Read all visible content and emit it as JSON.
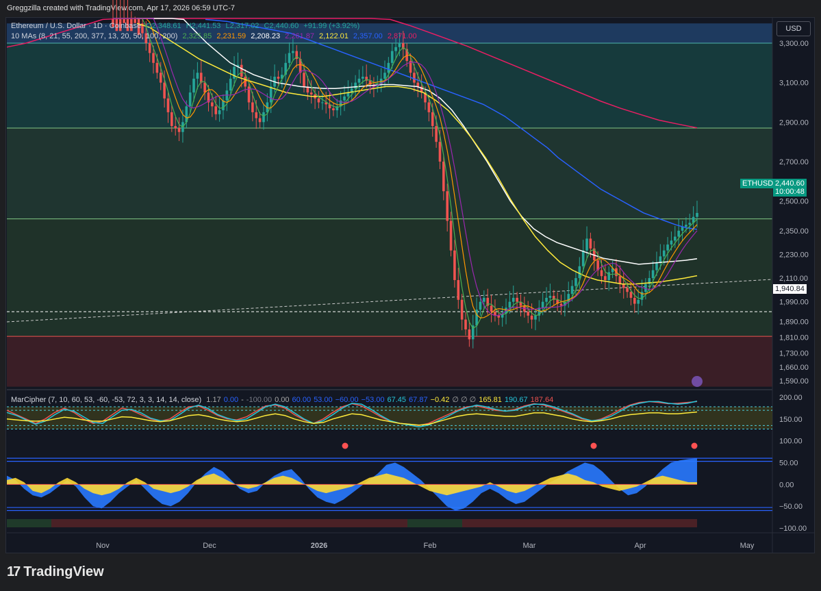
{
  "header": {
    "text": "Greggzilla created with TradingView.com, Apr 17, 2026 06:59 UTC-7"
  },
  "brand": {
    "logo": "17",
    "name": "TradingView"
  },
  "currency": "USD",
  "legend_main": {
    "symbol": "Ethereum / U.S. Dollar · 1D · Coinbase",
    "open": "O2,348.61",
    "high": "H2,441.53",
    "low": "L2,317.02",
    "close": "C2,440.60",
    "change": "+91.99 (+3.92%)"
  },
  "legend_ma": {
    "label": "10 MAs (8, 21, 55, 200, 377, 13, 20, 50, 100, 200)",
    "values": [
      {
        "v": "2,325.85",
        "color": "#4caf50"
      },
      {
        "v": "2,231.59",
        "color": "#ff9800"
      },
      {
        "v": "2,208.23",
        "color": "#ffffff"
      },
      {
        "v": "2,261.87",
        "color": "#9c27b0"
      },
      {
        "v": "2,122.01",
        "color": "#ffeb3b"
      },
      {
        "v": "2,357.00",
        "color": "#2962ff"
      },
      {
        "v": "2,871.00",
        "color": "#e91e63"
      }
    ]
  },
  "legend_mc": {
    "label": "MarCipher (7, 10, 60, 53, -60, -53, 72, 3, 3, 14, 14, close)",
    "values": [
      {
        "v": "1.17",
        "color": "#aaaaaa"
      },
      {
        "v": "0.00",
        "color": "#2962ff"
      },
      {
        "v": "-",
        "color": "#aaaaaa"
      },
      {
        "v": "-100.00",
        "color": "#787b86"
      },
      {
        "v": "0.00",
        "color": "#aaaaaa"
      },
      {
        "v": "60.00",
        "color": "#2962ff"
      },
      {
        "v": "53.00",
        "color": "#2962ff"
      },
      {
        "v": "−60.00",
        "color": "#2962ff"
      },
      {
        "v": "−53.00",
        "color": "#2962ff"
      },
      {
        "v": "67.45",
        "color": "#26c6da"
      },
      {
        "v": "67.87",
        "color": "#2962ff"
      },
      {
        "v": "−0.42",
        "color": "#ffeb3b"
      },
      {
        "v": "∅ ∅ ∅",
        "color": "#aaaaaa"
      },
      {
        "v": "165.81",
        "color": "#ffeb3b"
      },
      {
        "v": "190.67",
        "color": "#26c6da"
      },
      {
        "v": "187.64",
        "color": "#ef5350"
      }
    ]
  },
  "badges": {
    "symbol": "ETHUSD",
    "price": "2,440.60",
    "countdown": "10:00:48",
    "level": "1,940.84"
  },
  "chart_data": {
    "type": "candlestick",
    "x_labels": [
      "Nov",
      "Dec",
      "2026",
      "Feb",
      "Mar",
      "Apr",
      "May"
    ],
    "price_axis_ticks": [
      3300,
      3100,
      2900,
      2700,
      2500,
      2350,
      2230,
      2110,
      1990,
      1890,
      1810,
      1730,
      1660,
      1590
    ],
    "price_axis_labels": [
      "3,300.00",
      "3,100.00",
      "2,900.00",
      "2,700.00",
      "2,500.00",
      "2,350.00",
      "2,230.00",
      "2,110.00",
      "1,990.00",
      "1,890.00",
      "1,810.00",
      "1,730.00",
      "1,660.00",
      "1,590.00"
    ],
    "osc_axis_ticks": [
      200,
      150,
      100,
      50,
      0,
      -50,
      -100
    ],
    "osc_axis_labels": [
      "200.00",
      "150.00",
      "100.00",
      "50.00",
      "0.00",
      "−50.00",
      "−100.00"
    ],
    "zones": [
      {
        "from": 3300,
        "to": 3400,
        "color": "#1e3a5f"
      },
      {
        "from": 2870,
        "to": 3300,
        "color": "#163a3c"
      },
      {
        "from": 2410,
        "to": 2870,
        "color": "#1f3530"
      },
      {
        "from": 1815,
        "to": 2410,
        "color": "#1f3229"
      },
      {
        "from": 1560,
        "to": 1815,
        "color": "#3a1e26"
      }
    ],
    "hlines": [
      3300,
      2870,
      2410,
      1815
    ],
    "close_series": [
      3760,
      3700,
      3640,
      3620,
      3560,
      3500,
      3480,
      3400,
      3350,
      3300,
      3250,
      3200,
      3150,
      3100,
      3020,
      2950,
      2880,
      2870,
      2850,
      2900,
      2980,
      3050,
      3120,
      3150,
      3100,
      3050,
      3000,
      2980,
      2940,
      2960,
      3010,
      3060,
      3120,
      3180,
      3190,
      3130,
      3080,
      3000,
      2950,
      2920,
      2900,
      2950,
      3000,
      3080,
      3130,
      3120,
      3140,
      3200,
      3250,
      3260,
      3220,
      3150,
      3080,
      3050,
      3040,
      3020,
      3000,
      3000,
      2990,
      2970,
      2960,
      2980,
      3010,
      3030,
      3050,
      3070,
      3100,
      3120,
      3130,
      3110,
      3090,
      3080,
      3090,
      3120,
      3150,
      3200,
      3260,
      3280,
      3300,
      3270,
      3210,
      3150,
      3100,
      3080,
      3050,
      3000,
      2950,
      2880,
      2800,
      2700,
      2550,
      2400,
      2250,
      2100,
      2000,
      1900,
      1850,
      1800,
      1870,
      1950,
      1990,
      2010,
      1970,
      1940,
      1920,
      1910,
      1930,
      1960,
      1990,
      2010,
      1990,
      1970,
      1940,
      1920,
      1900,
      1920,
      1960,
      1990,
      2010,
      2020,
      2000,
      1980,
      1970,
      1990,
      2030,
      2070,
      2110,
      2170,
      2250,
      2310,
      2260,
      2200,
      2150,
      2120,
      2100,
      2140,
      2160,
      2120,
      2080,
      2060,
      2040,
      2010,
      1980,
      2000,
      2040,
      2080,
      2110,
      2150,
      2190,
      2220,
      2250,
      2280,
      2300,
      2320,
      2350,
      2370,
      2380,
      2390,
      2420,
      2440
    ],
    "ma_series": [
      {
        "name": "",
        "color": "#2962ff",
        "values": [
          3420,
          3415,
          3410,
          3400,
          3390,
          3380,
          3370,
          3360,
          3350,
          3330,
          3310,
          3290,
          3270,
          3250,
          3230,
          3210,
          3190,
          3170,
          3150,
          3130,
          3110,
          3090,
          3070,
          3050,
          3030,
          3010,
          2990,
          2960,
          2930,
          2890,
          2850,
          2810,
          2770,
          2720,
          2680,
          2640,
          2600,
          2560,
          2530,
          2500,
          2470,
          2440,
          2420,
          2400,
          2380,
          2365,
          2357
        ]
      },
      {
        "name": "",
        "color": "#e91e63",
        "values": [
          3280,
          3300,
          3330,
          3360,
          3390,
          3420,
          3440,
          3460,
          3480,
          3490,
          3500,
          3510,
          3515,
          3520,
          3520,
          3515,
          3505,
          3490,
          3470,
          3445,
          3420,
          3390,
          3355,
          3320,
          3285,
          3245,
          3205,
          3165,
          3125,
          3085,
          3045,
          3005,
          2970,
          2940,
          2910,
          2890,
          2871
        ]
      },
      {
        "name": "",
        "color": "#ffffff",
        "values": [
          3650,
          3600,
          3540,
          3480,
          3420,
          3360,
          3300,
          3250,
          3200,
          3170,
          3140,
          3120,
          3100,
          3090,
          3080,
          3075,
          3070,
          3070,
          3075,
          3080,
          3085,
          3090,
          3090,
          3085,
          3080,
          3060,
          3020,
          2960,
          2880,
          2790,
          2700,
          2600,
          2500,
          2420,
          2360,
          2320,
          2290,
          2270,
          2250,
          2230,
          2210,
          2200,
          2190,
          2180,
          2185,
          2190,
          2195,
          2200,
          2208
        ]
      },
      {
        "name": "",
        "color": "#ffeb3b",
        "values": [
          3400,
          3380,
          3340,
          3300,
          3260,
          3220,
          3190,
          3160,
          3130,
          3110,
          3090,
          3070,
          3050,
          3040,
          3030,
          3030,
          3040,
          3050,
          3060,
          3070,
          3080,
          3080,
          3070,
          3050,
          3010,
          2960,
          2890,
          2810,
          2720,
          2620,
          2510,
          2410,
          2320,
          2250,
          2190,
          2150,
          2120,
          2100,
          2090,
          2080,
          2080,
          2085,
          2090,
          2100,
          2110,
          2122
        ]
      }
    ],
    "osc_series": [
      {
        "name": "",
        "color": "#ef5350",
        "values": [
          170,
          160,
          150,
          140,
          150,
          165,
          175,
          165,
          150,
          140,
          145,
          160,
          175,
          170,
          160,
          150,
          145,
          150,
          165,
          178,
          180,
          170,
          158,
          150,
          148,
          155,
          168,
          180,
          182,
          175,
          160,
          148,
          140,
          150,
          165,
          178,
          185,
          180,
          168,
          155,
          145,
          140,
          138,
          135,
          140,
          150,
          160,
          170,
          178,
          180,
          175,
          170,
          168,
          172,
          180,
          185,
          182,
          175,
          168,
          160,
          150,
          145,
          150,
          160,
          172,
          182,
          188,
          190,
          188,
          185,
          186,
          188,
          190
        ]
      },
      {
        "name": "",
        "color": "#26c6da",
        "values": [
          165,
          158,
          148,
          138,
          145,
          160,
          172,
          168,
          155,
          142,
          140,
          155,
          170,
          172,
          164,
          152,
          146,
          146,
          160,
          175,
          182,
          174,
          160,
          152,
          146,
          150,
          164,
          178,
          184,
          178,
          164,
          150,
          140,
          146,
          160,
          175,
          186,
          184,
          172,
          158,
          146,
          140,
          136,
          132,
          136,
          146,
          156,
          168,
          176,
          182,
          178,
          172,
          168,
          170,
          178,
          184,
          184,
          178,
          170,
          162,
          152,
          146,
          148,
          156,
          168,
          180,
          186,
          190,
          190,
          186,
          184,
          186,
          191
        ]
      },
      {
        "name": "",
        "color": "#ffeb3b",
        "values": [
          150,
          148,
          146,
          145,
          146,
          150,
          154,
          152,
          148,
          145,
          145,
          150,
          155,
          154,
          150,
          146,
          144,
          146,
          152,
          158,
          160,
          156,
          150,
          146,
          144,
          146,
          152,
          158,
          162,
          158,
          150,
          144,
          140,
          142,
          150,
          156,
          162,
          160,
          154,
          148,
          144,
          140,
          138,
          136,
          138,
          144,
          150,
          156,
          160,
          162,
          160,
          158,
          156,
          156,
          160,
          164,
          164,
          160,
          156,
          150,
          146,
          144,
          146,
          150,
          156,
          160,
          162,
          164,
          164,
          162,
          162,
          164,
          166
        ]
      }
    ],
    "wave_series": [
      {
        "name": "",
        "color": "#2979ff",
        "values": [
          20,
          10,
          -10,
          -25,
          -30,
          -20,
          -5,
          10,
          -5,
          -30,
          -50,
          -55,
          -40,
          -20,
          -5,
          10,
          -10,
          -30,
          -45,
          -50,
          -40,
          -20,
          5,
          25,
          40,
          30,
          10,
          -10,
          -20,
          -15,
          5,
          20,
          30,
          35,
          15,
          -10,
          -30,
          -40,
          -45,
          -35,
          -20,
          -5,
          10,
          25,
          45,
          50,
          40,
          25,
          10,
          -10,
          -30,
          -50,
          -60,
          -55,
          -40,
          -20,
          -10,
          -20,
          -35,
          -45,
          -40,
          -25,
          -10,
          5,
          15,
          30,
          40,
          50,
          45,
          30,
          10,
          -10,
          -25,
          -20,
          -5,
          15,
          35,
          50,
          55,
          58,
          60
        ]
      },
      {
        "name": "",
        "color": "#fdd835",
        "values": [
          10,
          15,
          5,
          -15,
          -20,
          -10,
          5,
          15,
          5,
          -10,
          -20,
          -25,
          -20,
          -10,
          5,
          15,
          5,
          -10,
          -15,
          -20,
          -15,
          -5,
          10,
          20,
          25,
          15,
          5,
          -5,
          -10,
          -5,
          5,
          15,
          20,
          15,
          5,
          -5,
          -15,
          -20,
          -15,
          -10,
          -5,
          5,
          15,
          20,
          25,
          20,
          15,
          5,
          -5,
          -15,
          -20,
          -25,
          -20,
          -15,
          -10,
          -5,
          5,
          -5,
          -15,
          -20,
          -15,
          -5,
          5,
          15,
          20,
          25,
          20,
          10,
          5,
          -5,
          -10,
          -15,
          -10,
          -5,
          5,
          15,
          20,
          15,
          10,
          5,
          5
        ]
      }
    ]
  }
}
